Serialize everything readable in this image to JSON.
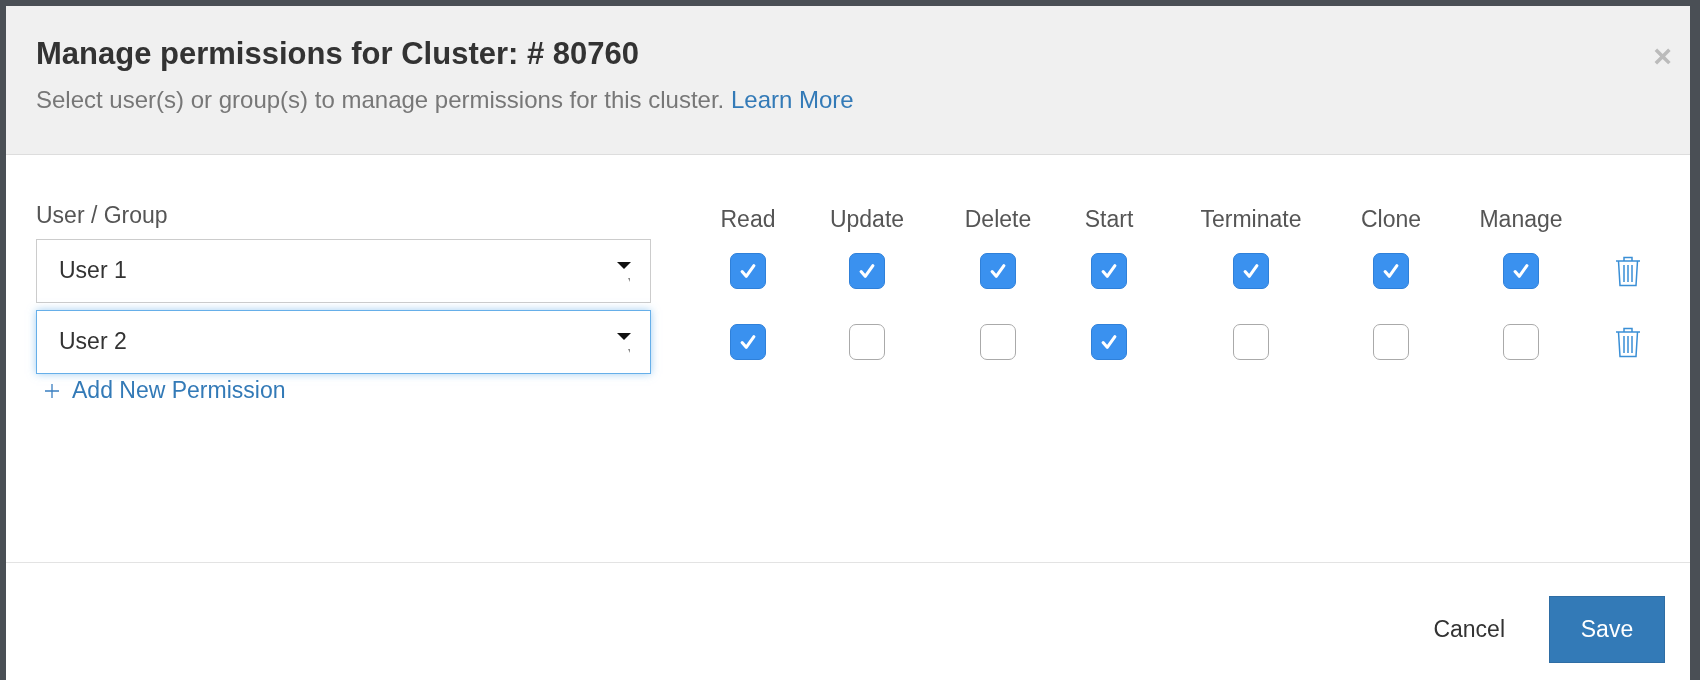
{
  "dialog": {
    "title": "Manage permissions for Cluster: # 80760",
    "subtitle": "Select user(s) or group(s) to manage permissions for this cluster.",
    "learn_more": "Learn More",
    "close": "×"
  },
  "permissions": {
    "user_column": "User / Group",
    "columns": [
      "Read",
      "Update",
      "Delete",
      "Start",
      "Terminate",
      "Clone",
      "Manage"
    ],
    "rows": [
      {
        "user": "User 1",
        "focused": false,
        "checks": [
          {
            "checked": true
          },
          {
            "checked": true
          },
          {
            "checked": true
          },
          {
            "checked": true
          },
          {
            "checked": true
          },
          {
            "checked": true
          },
          {
            "checked": true
          }
        ]
      },
      {
        "user": "User 2",
        "focused": true,
        "checks": [
          {
            "checked": true
          },
          {
            "checked": false
          },
          {
            "checked": false
          },
          {
            "checked": true
          },
          {
            "checked": false
          },
          {
            "checked": false
          },
          {
            "checked": false
          }
        ]
      }
    ],
    "add_link": "Add New Permission"
  },
  "buttons": [
    {
      "label": "Cancel",
      "kind": "link"
    },
    {
      "label": "Save",
      "kind": "primary"
    }
  ]
}
